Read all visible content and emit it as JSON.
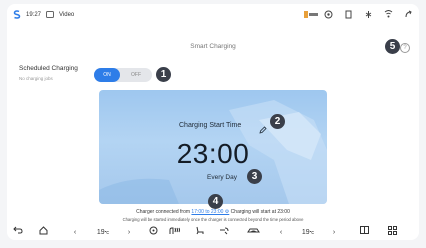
{
  "status_bar": {
    "time": "19:27",
    "app": "Video",
    "icons": [
      "app-logo-icon",
      "bluetooth-icon",
      "battery-icon",
      "wifi-icon",
      "signal-icon",
      "close-app-icon"
    ]
  },
  "page": {
    "title": "Smart Charging"
  },
  "scheduled": {
    "label": "Scheduled Charging",
    "sub": "No charging jobs",
    "on_label": "ON",
    "off_label": "OFF",
    "state": "on"
  },
  "card": {
    "title": "Charging Start Time",
    "time": "23:00",
    "repeat": "Every Day"
  },
  "notes": {
    "line1_prefix": "Charger connected from",
    "line1_link": "17:00 to 23:00 ⚙",
    "line1_suffix": "Charging will start at 23:00",
    "line2": "Charging will be started immediately once the charger is connected beyond the time period above"
  },
  "badges": {
    "b1": "1",
    "b2": "2",
    "b3": "3",
    "b4": "4",
    "b5": "5"
  },
  "nav": {
    "temp_left": "19",
    "temp_right": "19",
    "unit": "℃"
  },
  "colors": {
    "accent": "#2e7de8",
    "card": "#a8cbee",
    "badge": "#3a3f4a"
  }
}
